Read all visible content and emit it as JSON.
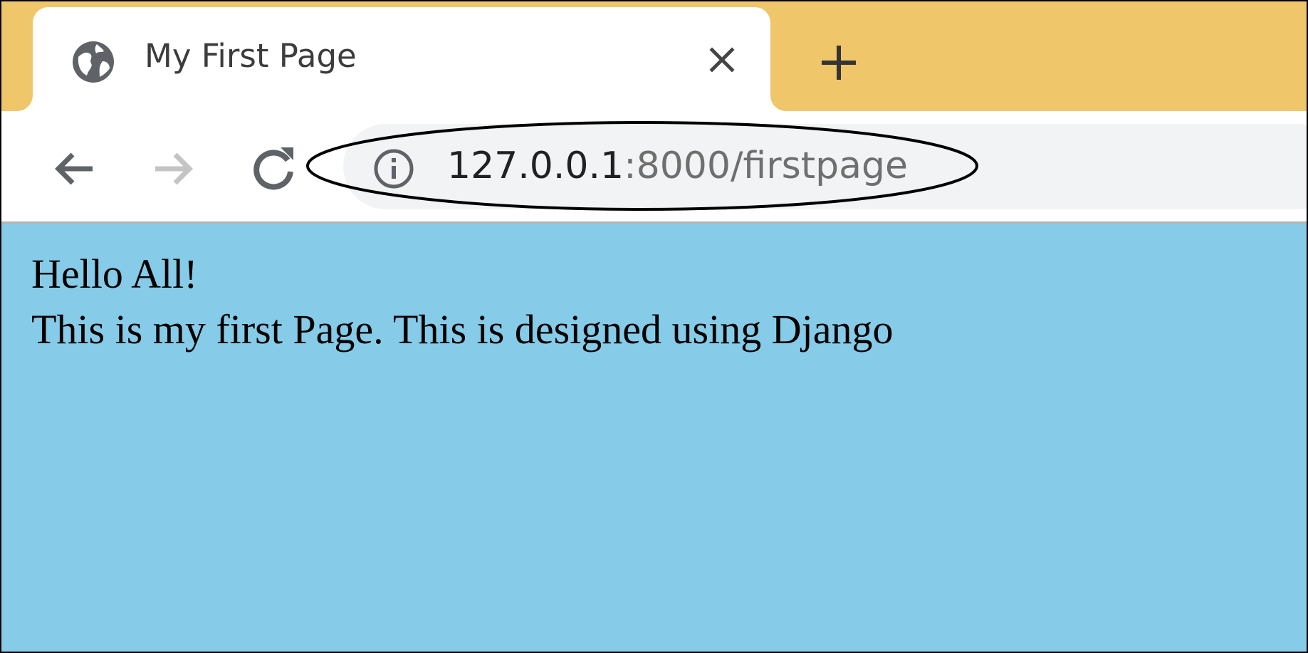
{
  "browser": {
    "tab": {
      "title": "My First Page",
      "favicon": "globe-icon",
      "close_icon": "close-icon"
    },
    "new_tab_icon": "plus-icon",
    "nav": {
      "back_icon": "arrow-left-icon",
      "forward_icon": "arrow-right-icon",
      "reload_icon": "reload-icon"
    },
    "address_bar": {
      "security_icon": "info-icon",
      "host": "127.0.0.1",
      "path": ":8000/firstpage"
    }
  },
  "page": {
    "lines": [
      "Hello All!",
      "This is my first Page. This is designed using Django"
    ]
  },
  "colors": {
    "tab_strip": "#efc66a",
    "page_background": "#86cbe7",
    "omnibox": "#f1f3f4"
  }
}
